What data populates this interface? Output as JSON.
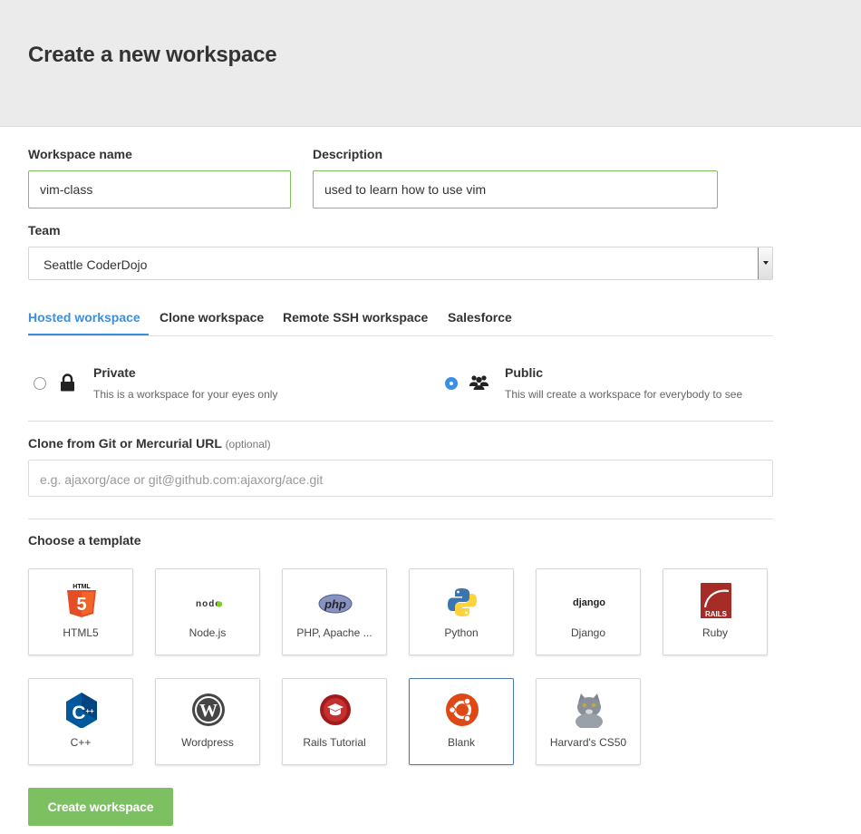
{
  "page": {
    "title": "Create a new workspace"
  },
  "form": {
    "name_label": "Workspace name",
    "name_value": "vim-class",
    "desc_label": "Description",
    "desc_value": "used to learn how to use vim",
    "team_label": "Team",
    "team_value": "Seattle CoderDojo"
  },
  "tabs": [
    {
      "label": "Hosted workspace",
      "active": true
    },
    {
      "label": "Clone workspace",
      "active": false
    },
    {
      "label": "Remote SSH workspace",
      "active": false
    },
    {
      "label": "Salesforce",
      "active": false
    }
  ],
  "visibility": {
    "private": {
      "title": "Private",
      "desc": "This is a workspace for your eyes only",
      "icon": "lock-icon",
      "checked": false
    },
    "public": {
      "title": "Public",
      "desc": "This will create a workspace for everybody to see",
      "icon": "users-icon",
      "checked": true
    }
  },
  "clone": {
    "label": "Clone from Git or Mercurial URL",
    "optional": "(optional)",
    "placeholder": "e.g. ajaxorg/ace or git@github.com:ajaxorg/ace.git"
  },
  "templates": {
    "label": "Choose a template",
    "items": [
      {
        "name": "HTML5",
        "icon": "html5-icon"
      },
      {
        "name": "Node.js",
        "icon": "nodejs-icon"
      },
      {
        "name": "PHP, Apache ...",
        "icon": "php-icon"
      },
      {
        "name": "Python",
        "icon": "python-icon"
      },
      {
        "name": "Django",
        "icon": "django-icon"
      },
      {
        "name": "Ruby",
        "icon": "rails-icon"
      },
      {
        "name": "C++",
        "icon": "cpp-icon"
      },
      {
        "name": "Wordpress",
        "icon": "wordpress-icon"
      },
      {
        "name": "Rails Tutorial",
        "icon": "rails-tutorial-icon"
      },
      {
        "name": "Blank",
        "icon": "ubuntu-icon",
        "selected": true
      },
      {
        "name": "Harvard's CS50",
        "icon": "cat-icon"
      }
    ],
    "icon_text": {
      "html": "HTML",
      "html_5": "5",
      "node": "node",
      "php": "php",
      "django": "django",
      "rails": "RAILS",
      "cpp": "C",
      "cpp_plus": "++",
      "wp": "W"
    }
  },
  "submit": {
    "label": "Create workspace"
  },
  "colors": {
    "accent": "#3d8ede",
    "success": "#7cc062",
    "valid_border": "#7fbf5e"
  }
}
